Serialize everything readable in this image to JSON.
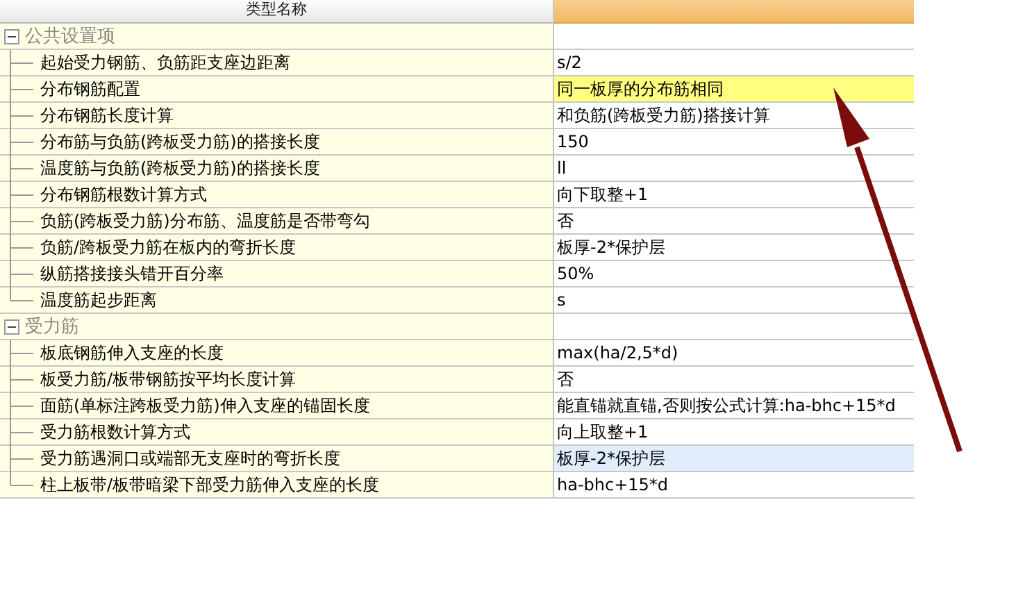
{
  "header": {
    "title": "类型名称"
  },
  "groups": [
    {
      "name": "公共设置项",
      "expanded": true,
      "children": [
        {
          "name": "起始受力钢筋、负筋距支座边距离",
          "value": "s/2",
          "selected": false,
          "hovered": false
        },
        {
          "name": "分布钢筋配置",
          "value": "同一板厚的分布筋相同",
          "selected": true,
          "hovered": false
        },
        {
          "name": "分布钢筋长度计算",
          "value": "和负筋(跨板受力筋)搭接计算",
          "selected": false,
          "hovered": false
        },
        {
          "name": "分布筋与负筋(跨板受力筋)的搭接长度",
          "value": "150",
          "selected": false,
          "hovered": false
        },
        {
          "name": "温度筋与负筋(跨板受力筋)的搭接长度",
          "value": "ll",
          "selected": false,
          "hovered": false
        },
        {
          "name": "分布钢筋根数计算方式",
          "value": "向下取整+1",
          "selected": false,
          "hovered": false
        },
        {
          "name": "负筋(跨板受力筋)分布筋、温度筋是否带弯勾",
          "value": "否",
          "selected": false,
          "hovered": false
        },
        {
          "name": "负筋/跨板受力筋在板内的弯折长度",
          "value": "板厚-2*保护层",
          "selected": false,
          "hovered": false
        },
        {
          "name": "纵筋搭接接头错开百分率",
          "value": "50%",
          "selected": false,
          "hovered": false
        },
        {
          "name": "温度筋起步距离",
          "value": "s",
          "selected": false,
          "hovered": false
        }
      ]
    },
    {
      "name": "受力筋",
      "expanded": true,
      "children": [
        {
          "name": "板底钢筋伸入支座的长度",
          "value": "max(ha/2,5*d)",
          "selected": false,
          "hovered": false
        },
        {
          "name": "板受力筋/板带钢筋按平均长度计算",
          "value": "否",
          "selected": false,
          "hovered": false
        },
        {
          "name": "面筋(单标注跨板受力筋)伸入支座的锚固长度",
          "value": "能直锚就直锚,否则按公式计算:ha-bhc+15*d",
          "selected": false,
          "hovered": false
        },
        {
          "name": "受力筋根数计算方式",
          "value": "向上取整+1",
          "selected": false,
          "hovered": false
        },
        {
          "name": "受力筋遇洞口或端部无支座时的弯折长度",
          "value": "板厚-2*保护层",
          "selected": false,
          "hovered": true
        },
        {
          "name": "柱上板带/板带暗梁下部受力筋伸入支座的长度",
          "value": "ha-bhc+15*d",
          "selected": false,
          "hovered": false
        }
      ]
    }
  ],
  "overlay": [
    {
      "kind": "arrow"
    }
  ]
}
